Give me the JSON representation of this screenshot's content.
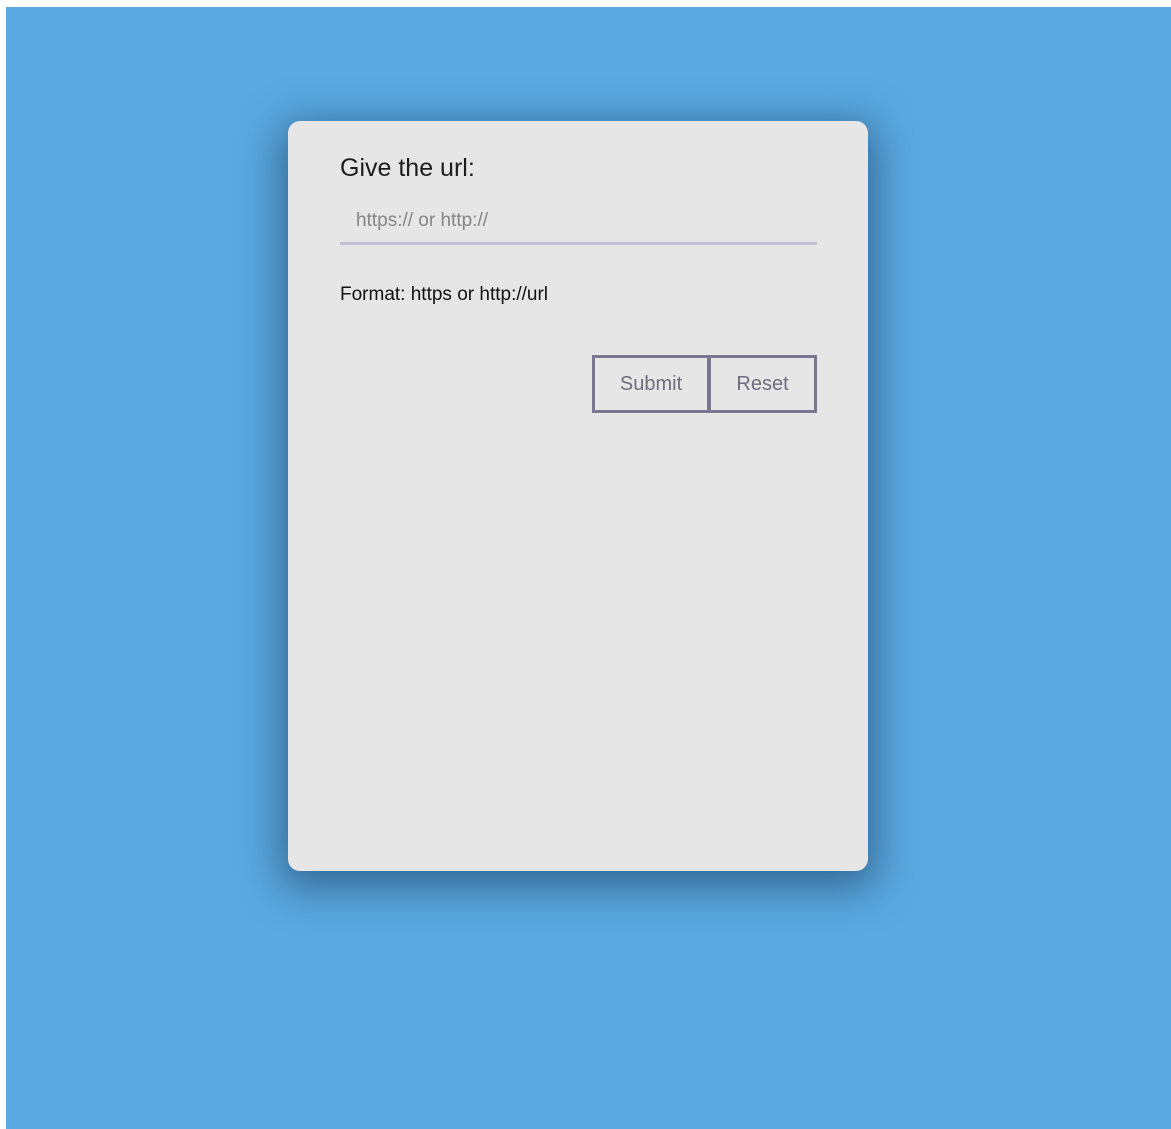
{
  "form": {
    "label": "Give the url:",
    "url_input": {
      "value": "",
      "placeholder": "https:// or http://"
    },
    "hint": "Format: https or http://url",
    "submit_label": "Submit",
    "reset_label": "Reset"
  },
  "colors": {
    "background": "#5aa9e0",
    "card": "#e6e6e6",
    "input_underline": "#c3c0d4",
    "button_border": "#7a7690"
  }
}
